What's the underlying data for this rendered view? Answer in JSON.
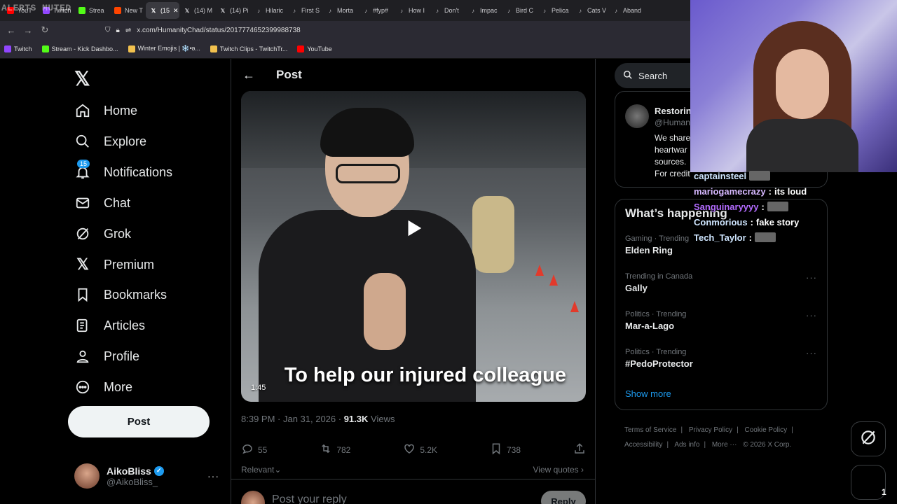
{
  "browser": {
    "overlay_text": "ALERTS MUTED",
    "tabs": [
      {
        "label": "YouT",
        "color": "#ff0000"
      },
      {
        "label": "Twitch",
        "color": "#9146ff"
      },
      {
        "label": "Strea",
        "color": "#53fc18"
      },
      {
        "label": "New T",
        "color": "#ff4500"
      },
      {
        "label": "(15",
        "color": "#ffffff",
        "active": true
      },
      {
        "label": "(14) M",
        "color": "#ffffff"
      },
      {
        "label": "(14) Pi",
        "color": "#ffffff"
      },
      {
        "label": "Hilaric",
        "color": "#ffffff"
      },
      {
        "label": "First S",
        "color": "#ffffff"
      },
      {
        "label": "Morta",
        "color": "#ffffff"
      },
      {
        "label": "#fyp#",
        "color": "#ffffff"
      },
      {
        "label": "How I",
        "color": "#ffffff"
      },
      {
        "label": "Don't",
        "color": "#ffffff"
      },
      {
        "label": "Impac",
        "color": "#ffffff"
      },
      {
        "label": "Bird C",
        "color": "#ffffff"
      },
      {
        "label": "Pelica",
        "color": "#ffffff"
      },
      {
        "label": "Cats V",
        "color": "#ffffff"
      },
      {
        "label": "Aband",
        "color": "#ffffff"
      }
    ],
    "url": "x.com/HumanityChad/status/2017774652399988738",
    "bookmarks": [
      {
        "label": "Twitch",
        "color": "#9146ff"
      },
      {
        "label": "Stream - Kick Dashbo...",
        "color": "#53fc18"
      },
      {
        "label": "Winter Emojis | ❄️•ʚ...",
        "color": "#f2c14e"
      },
      {
        "label": "Twitch Clips - TwitchTr...",
        "color": "#f2c14e"
      },
      {
        "label": "YouTube",
        "color": "#ff0000"
      }
    ]
  },
  "nav": {
    "items": [
      {
        "label": "Home",
        "icon": "home-icon"
      },
      {
        "label": "Explore",
        "icon": "search-icon"
      },
      {
        "label": "Notifications",
        "icon": "bell-icon",
        "badge": "15"
      },
      {
        "label": "Chat",
        "icon": "mail-icon"
      },
      {
        "label": "Grok",
        "icon": "grok-icon"
      },
      {
        "label": "Premium",
        "icon": "x-icon"
      },
      {
        "label": "Bookmarks",
        "icon": "bookmark-icon"
      },
      {
        "label": "Articles",
        "icon": "article-icon"
      },
      {
        "label": "Profile",
        "icon": "person-icon"
      },
      {
        "label": "More",
        "icon": "more-circle-icon"
      }
    ],
    "post_button": "Post",
    "account": {
      "name": "AikoBliss",
      "handle": "@AikoBliss_"
    }
  },
  "post": {
    "header_title": "Post",
    "video_caption": "To help our injured colleague",
    "video_duration": "1:45",
    "timestamp": "8:39 PM · Jan 31, 2026 · ",
    "views_count": "91.3K",
    "views_label": " Views",
    "replies": "55",
    "reposts": "782",
    "likes": "5.2K",
    "bookmarks": "738",
    "sort_label": "Relevant",
    "view_quotes": "View quotes",
    "reply_placeholder": "Post your reply",
    "reply_button": "Reply"
  },
  "sidebar": {
    "search_placeholder": "Search",
    "relevant_person": {
      "name": "Restorin",
      "handle": "@Human",
      "bio_lines": [
        "We share",
        "heartwar",
        "sources.",
        "For credit"
      ]
    },
    "happening_title": "What’s happening",
    "trends": [
      {
        "category": "Gaming · Trending",
        "name": "Elden Ring"
      },
      {
        "category": "Trending in Canada",
        "name": "Gally"
      },
      {
        "category": "Politics · Trending",
        "name": "Mar-a-Lago"
      },
      {
        "category": "Politics · Trending",
        "name": "#PedoProtector"
      }
    ],
    "show_more": "Show more",
    "footer": [
      "Terms of Service",
      "|",
      "Privacy Policy",
      "|",
      "Cookie Policy",
      "|",
      "Accessibility",
      "|",
      "Ads info",
      "|",
      "More ···",
      "© 2026 X Corp."
    ],
    "messages_count": "1"
  },
  "stream_chat": [
    {
      "user": "captainsteel",
      "message": ""
    },
    {
      "user": "mariogamecrazy",
      "message": "its loud"
    },
    {
      "user": "Sanguinaryyyy",
      "message": ""
    },
    {
      "user": "Conmorious",
      "message": "fake story"
    },
    {
      "user": "Tech_Taylor",
      "message": ""
    }
  ],
  "colors": {
    "accent": "#1d9bf0",
    "background": "#000000",
    "muted": "#71767b",
    "text": "#e7e9ea"
  }
}
